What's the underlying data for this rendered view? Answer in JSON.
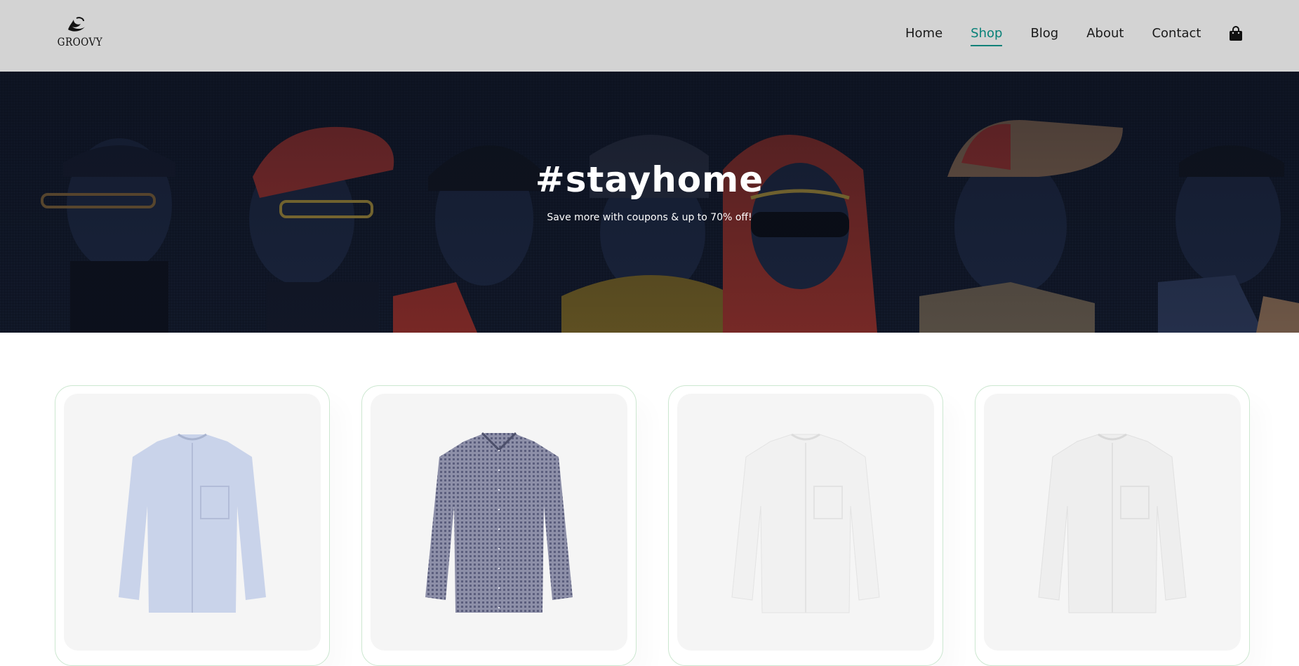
{
  "brand": {
    "name": "GROOVY",
    "logo_icon": "swirl-logo-icon"
  },
  "nav": {
    "items": [
      {
        "label": "Home",
        "active": false
      },
      {
        "label": "Shop",
        "active": true
      },
      {
        "label": "Blog",
        "active": false
      },
      {
        "label": "About",
        "active": false
      },
      {
        "label": "Contact",
        "active": false
      }
    ],
    "cart_icon": "shopping-bag-icon",
    "accent_color": "#088178"
  },
  "hero": {
    "title": "#stayhome",
    "subtitle": "Save more with coupons & up to 70% off!",
    "background": "illustrated-characters-banner"
  },
  "products": [
    {
      "image": "light-blue-oxford-band-collar-shirt",
      "color": "#c9d3ea"
    },
    {
      "image": "navy-gingham-check-shirt",
      "color": "#6f7291"
    },
    {
      "image": "white-linen-band-collar-shirt",
      "color": "#f1f1f1"
    },
    {
      "image": "white-linen-band-collar-shirt",
      "color": "#eeeeee"
    }
  ],
  "colors": {
    "header_bg": "#d3d3d3",
    "card_border": "#cce7d0",
    "hero_bg": "#121a2b"
  }
}
